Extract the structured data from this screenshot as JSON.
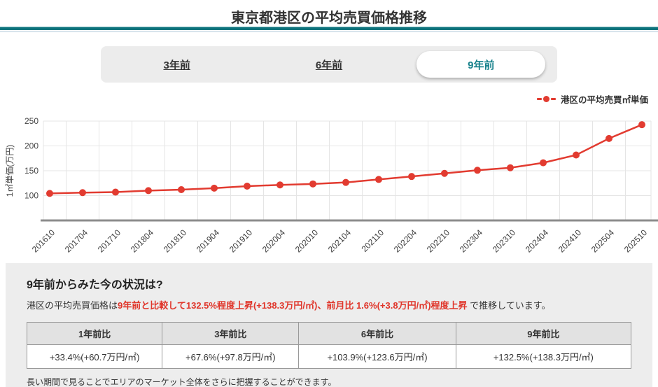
{
  "header": {
    "title": "東京都港区の平均売買価格推移"
  },
  "tabs": [
    {
      "label": "3年前",
      "active": false
    },
    {
      "label": "6年前",
      "active": false
    },
    {
      "label": "9年前",
      "active": true
    }
  ],
  "legend": {
    "label": "港区の平均売買㎡単価"
  },
  "chart_data": {
    "type": "line",
    "series_name": "港区の平均売買㎡単価",
    "categories": [
      "201610",
      "201704",
      "201710",
      "201804",
      "201810",
      "201904",
      "201910",
      "202004",
      "202010",
      "202104",
      "202110",
      "202204",
      "202210",
      "202304",
      "202310",
      "202404",
      "202410",
      "202504",
      "202510"
    ],
    "values": [
      104.4,
      106.0,
      107.0,
      110.0,
      112.0,
      115.0,
      119.0,
      121.5,
      123.5,
      126.5,
      132.5,
      138.5,
      144.7,
      151.0,
      156.0,
      166.0,
      181.7,
      215.0,
      242.7
    ],
    "ylabel": "1㎡単価(万円)",
    "yticks": [
      100,
      150,
      200,
      250
    ],
    "ymin": 50,
    "ymax": 260,
    "grid": true,
    "legend_position": "top-right",
    "line_color": "#e23b30"
  },
  "summary": {
    "heading": "9年前からみた今の状況は?",
    "text_prefix": "港区の平均売買価格は",
    "text_highlight": "9年前と比較して132.5%程度上昇(+138.3万円/㎡)、前月比 1.6%(+3.8万円/㎡)程度上昇",
    "text_suffix": " で推移しています。",
    "table": {
      "headers": [
        "1年前比",
        "3年前比",
        "6年前比",
        "9年前比"
      ],
      "values": [
        "+33.4%(+60.7万円/㎡)",
        "+67.6%(+97.8万円/㎡)",
        "+103.9%(+123.6万円/㎡)",
        "+132.5%(+138.3万円/㎡)"
      ]
    },
    "note": "長い期間で見ることでエリアのマーケット全体をさらに把握することができます。"
  },
  "colors": {
    "accent_teal": "#18828c",
    "divider_teal": "#0d737c",
    "line_red": "#e23b30",
    "text_red": "#e0352a",
    "grid": "#e5e5e5",
    "axis": "#8c8c8c",
    "panel_bg": "#ededed",
    "table_header_bg": "#e2e2e2"
  }
}
